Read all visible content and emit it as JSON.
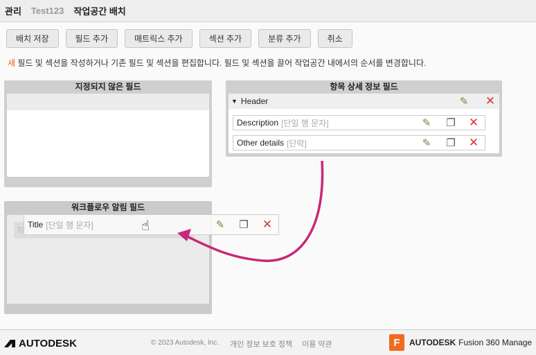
{
  "breadcrumb": {
    "root": "관리",
    "workspace": "Test123",
    "current": "작업공간 배치"
  },
  "toolbar": {
    "save": "배치 저장",
    "add_field": "필드 추가",
    "add_matrix": "매트릭스 추가",
    "add_section": "섹션 추가",
    "add_classification": "분류 추가",
    "cancel": "취소"
  },
  "info": {
    "first": "새",
    "rest": " 필드 및 섹션을 작성하거나 기존 필드 및 섹션을 편집합니다. 필드 및 섹션을 끌어 작업공간 내에서의 순서를 변경합니다."
  },
  "unassigned": {
    "title": "지정되지 않은 필드"
  },
  "details": {
    "title": "항목 상세 정보 필드",
    "section": "Header",
    "fields": [
      {
        "name": "Description",
        "type": "[단일 행 문자]"
      },
      {
        "name": "Other details",
        "type": "[단락]"
      }
    ]
  },
  "workflow": {
    "title": "워크플로우 알림 필드",
    "ghost_name": "Title",
    "ghost_type": "[단일 행 문자]"
  },
  "drag": {
    "name": "Title",
    "type": "[단일 행 문자]"
  },
  "footer": {
    "logo": "AUTODESK",
    "copyright": "© 2023 Autodesk, Inc.",
    "privacy": "개인 정보 보호 정책",
    "terms": "이용 약관",
    "product_brand": "AUTODESK",
    "product_name": "Fusion 360 Manage",
    "product_icon_letter": "F"
  },
  "colors": {
    "accent": "#e0651b",
    "arrow": "#c8287a"
  }
}
